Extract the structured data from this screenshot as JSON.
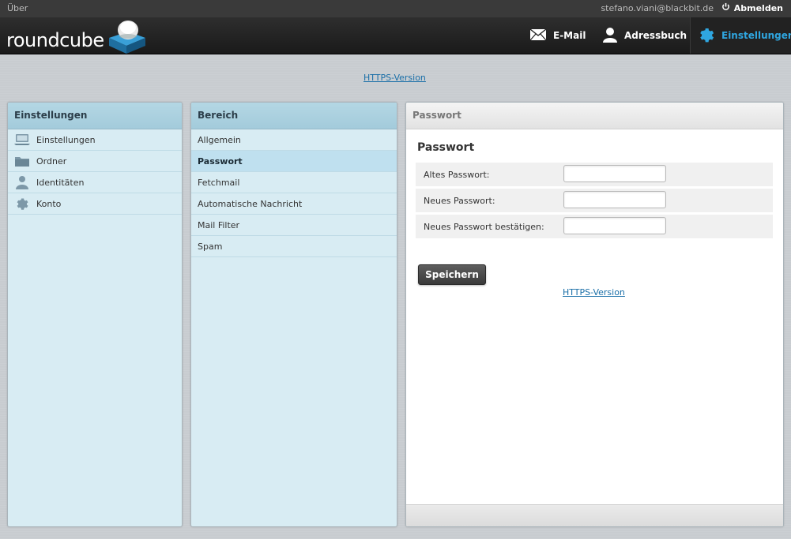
{
  "topbar": {
    "about": "Über",
    "username": "stefano.viani@blackbit.de",
    "logout": "Abmelden"
  },
  "header": {
    "logo_text": "roundcube",
    "nav": {
      "mail": "E-Mail",
      "addressbook": "Adressbuch",
      "settings": "Einstellungen"
    }
  },
  "https_top": "HTTPS-Version",
  "settings_panel": {
    "title": "Einstellungen",
    "items": [
      {
        "label": "Einstellungen",
        "icon": "computer-icon"
      },
      {
        "label": "Ordner",
        "icon": "folder-icon"
      },
      {
        "label": "Identitäten",
        "icon": "person-icon"
      },
      {
        "label": "Konto",
        "icon": "gear-icon"
      }
    ]
  },
  "section_panel": {
    "title": "Bereich",
    "items": [
      "Allgemein",
      "Passwort",
      "Fetchmail",
      "Automatische Nachricht",
      "Mail Filter",
      "Spam"
    ],
    "selected": "Passwort"
  },
  "main": {
    "header": "Passwort",
    "title": "Passwort",
    "fields": {
      "old_label": "Altes Passwort:",
      "new_label": "Neues Passwort:",
      "confirm_label": "Neues Passwort bestätigen:",
      "old_value": "",
      "new_value": "",
      "confirm_value": ""
    },
    "save": "Speichern",
    "https": "HTTPS-Version"
  },
  "colors": {
    "accent": "#2fa6e0",
    "panel_bg": "#d8ecf3",
    "topbar_bg": "#3a3a3a",
    "link": "#1a6fa8"
  }
}
